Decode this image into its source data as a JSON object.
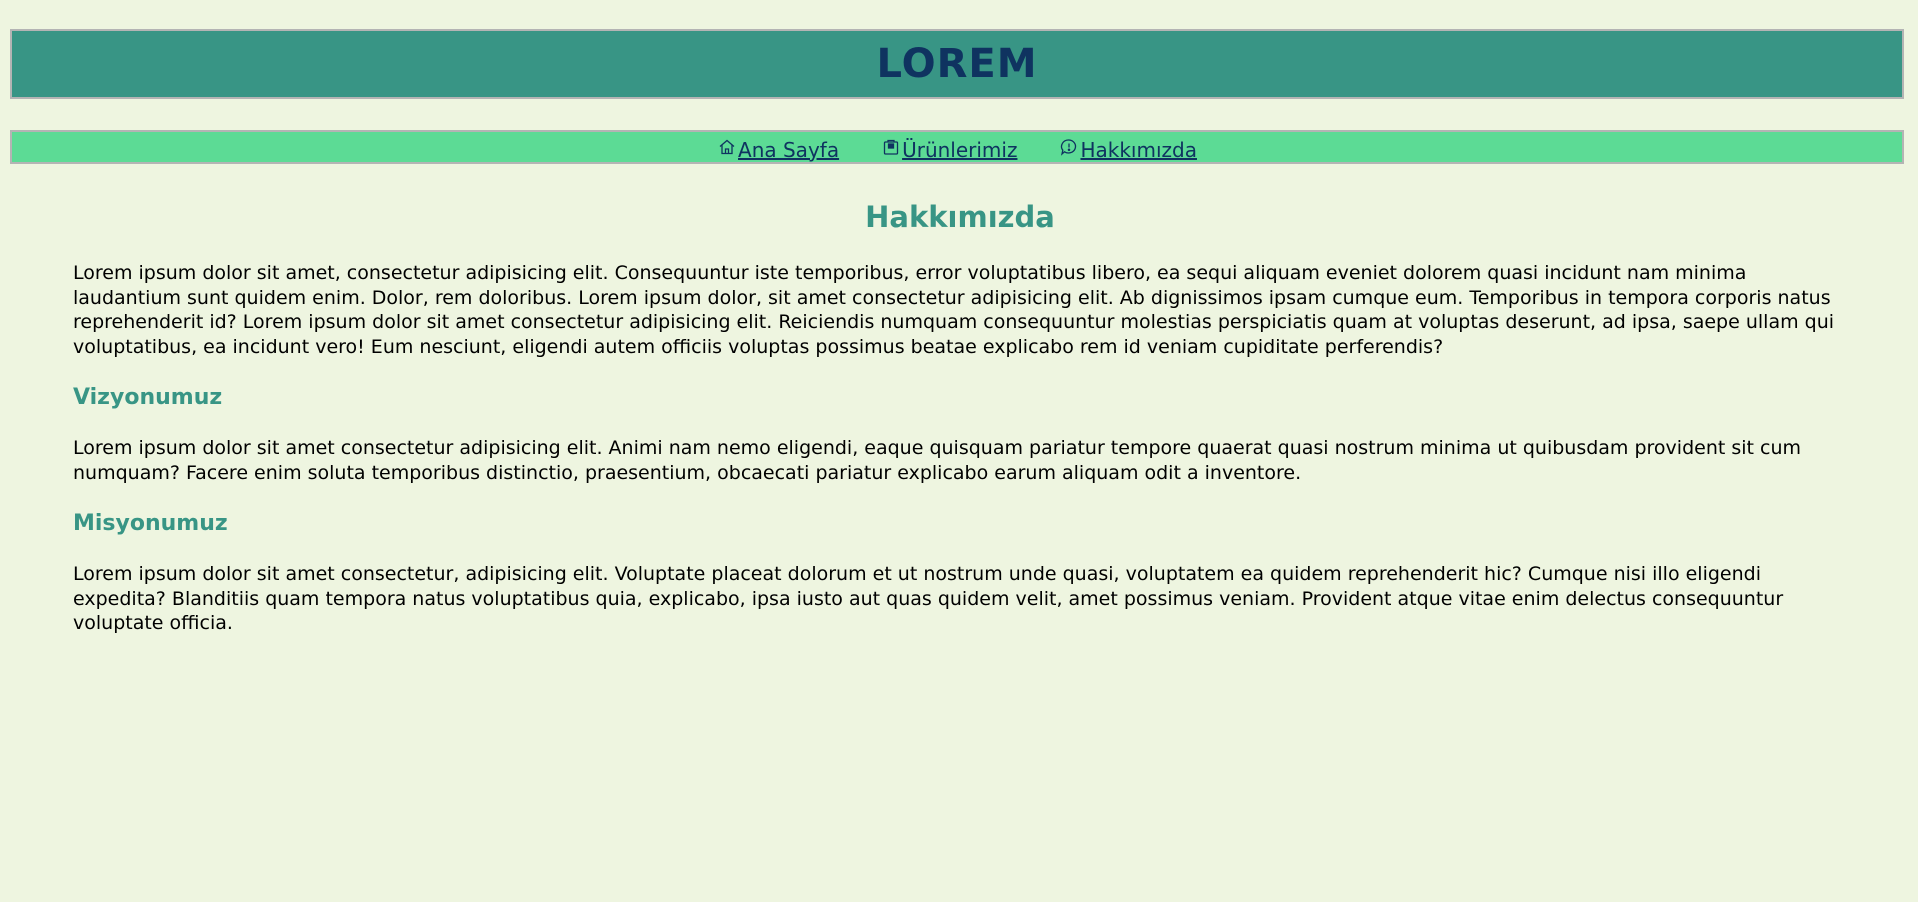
{
  "header": {
    "title": "LOREM"
  },
  "nav": {
    "items": [
      {
        "label": "Ana Sayfa ",
        "icon": "home-icon"
      },
      {
        "label": "Ürünlerimiz",
        "icon": "shopping-bag-icon"
      },
      {
        "label": " Hakkımızda",
        "icon": "chat-info-icon"
      }
    ]
  },
  "main": {
    "title": "Hakkımızda",
    "intro": "Lorem ipsum dolor sit amet, consectetur adipisicing elit. Consequuntur iste temporibus, error voluptatibus libero, ea sequi aliquam eveniet dolorem quasi incidunt nam minima laudantium sunt quidem enim. Dolor, rem doloribus. Lorem ipsum dolor, sit amet consectetur adipisicing elit. Ab dignissimos ipsam cumque eum. Temporibus in tempora corporis natus reprehenderit id? Lorem ipsum dolor sit amet consectetur adipisicing elit. Reiciendis numquam consequuntur molestias perspiciatis quam at voluptas deserunt, ad ipsa, saepe ullam qui voluptatibus, ea incidunt vero! Eum nesciunt, eligendi autem officiis voluptas possimus beatae explicabo rem id veniam cupiditate perferendis?",
    "vision": {
      "heading": "Vizyonumuz",
      "text": "Lorem ipsum dolor sit amet consectetur adipisicing elit. Animi nam nemo eligendi, eaque quisquam pariatur tempore quaerat quasi nostrum minima ut quibusdam provident sit cum numquam? Facere enim soluta temporibus distinctio, praesentium, obcaecati pariatur explicabo earum aliquam odit a inventore."
    },
    "mission": {
      "heading": "Misyonumuz",
      "text": "Lorem ipsum dolor sit amet consectetur, adipisicing elit. Voluptate placeat dolorum et ut nostrum unde quasi, voluptatem ea quidem reprehenderit hic? Cumque nisi illo eligendi expedita? Blanditiis quam tempora natus voluptatibus quia, explicabo, ipsa iusto aut quas quidem velit, amet possimus veniam. Provident atque vitae enim delectus consequuntur voluptate officia."
    }
  },
  "colors": {
    "background": "#eef5e0",
    "header_bg": "#389585",
    "header_text": "#0f3360",
    "nav_bg": "#5cdb95",
    "heading": "#389585"
  }
}
